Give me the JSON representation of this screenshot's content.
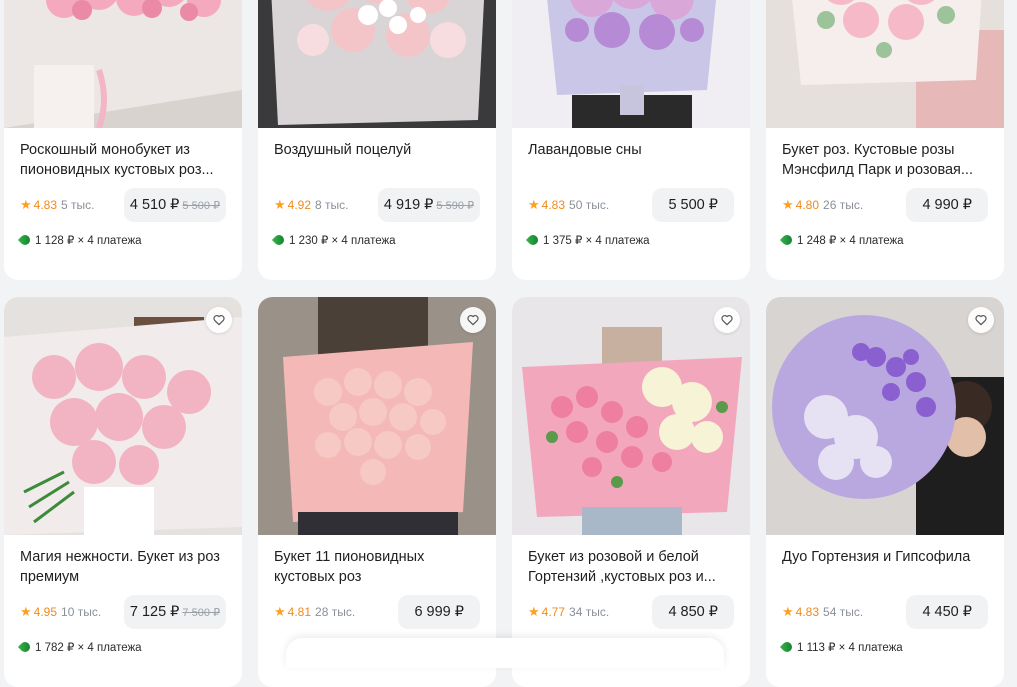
{
  "currency": "₽",
  "installment_suffix": "× 4 платежа",
  "rows": [
    {
      "cards": [
        {
          "title": "Роскошный монобукет из пионовидных кустовых роз...",
          "rating": "4.83",
          "reviews": "5 тыс.",
          "price": "4 510 ₽",
          "old_price": "5 500 ₽",
          "installment": "1 128 ₽ × 4 платежа"
        },
        {
          "title": "Воздушный поцелуй",
          "rating": "4.92",
          "reviews": "8 тыс.",
          "price": "4 919 ₽",
          "old_price": "5 590 ₽",
          "installment": "1 230 ₽ × 4 платежа"
        },
        {
          "title": "Лавандовые сны",
          "rating": "4.83",
          "reviews": "50 тыс.",
          "price": "5 500 ₽",
          "old_price": "",
          "installment": "1 375 ₽ × 4 платежа"
        },
        {
          "title": "Букет роз. Кустовые розы Мэнсфилд Парк и розовая...",
          "rating": "4.80",
          "reviews": "26 тыс.",
          "price": "4 990 ₽",
          "old_price": "",
          "installment": "1 248 ₽ × 4 платежа"
        }
      ]
    },
    {
      "cards": [
        {
          "title": "Магия нежности. Букет из роз премиум",
          "rating": "4.95",
          "reviews": "10 тыс.",
          "price": "7 125 ₽",
          "old_price": "7 500 ₽",
          "installment": "1 782 ₽ × 4 платежа"
        },
        {
          "title": "Букет 11 пионовидных кустовых роз",
          "rating": "4.81",
          "reviews": "28 тыс.",
          "price": "6 999 ₽",
          "old_price": "",
          "installment": ""
        },
        {
          "title": "Букет из розовой и белой Гортензий ,кустовых роз и...",
          "rating": "4.77",
          "reviews": "34 тыс.",
          "price": "4 850 ₽",
          "old_price": "",
          "installment": ""
        },
        {
          "title": "Дуо Гортензия и Гипсофила",
          "rating": "4.83",
          "reviews": "54 тыс.",
          "price": "4 450 ₽",
          "old_price": "",
          "installment": "1 113 ₽ × 4 платежа"
        }
      ]
    }
  ],
  "colors": {
    "background": "#f2f3f5",
    "card": "#ffffff",
    "rating": "#f08a1c",
    "price_box": "#f1f2f4",
    "installment_icon": "#1f9a3c"
  },
  "icons": {
    "favorite": "heart-outline-icon",
    "rating": "star-icon",
    "installment": "split-payment-leaf-icon"
  }
}
